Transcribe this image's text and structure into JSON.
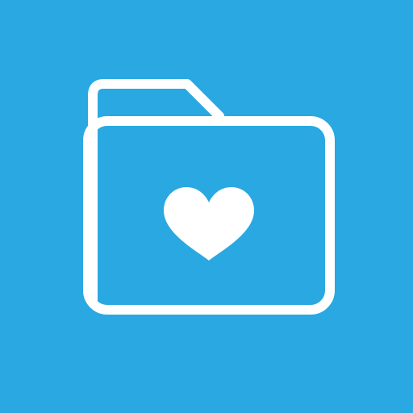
{
  "icon": {
    "name": "folder-heart-icon",
    "colors": {
      "background": "#29a8e2",
      "stroke": "#ffffff",
      "heart": "#ffffff"
    }
  }
}
